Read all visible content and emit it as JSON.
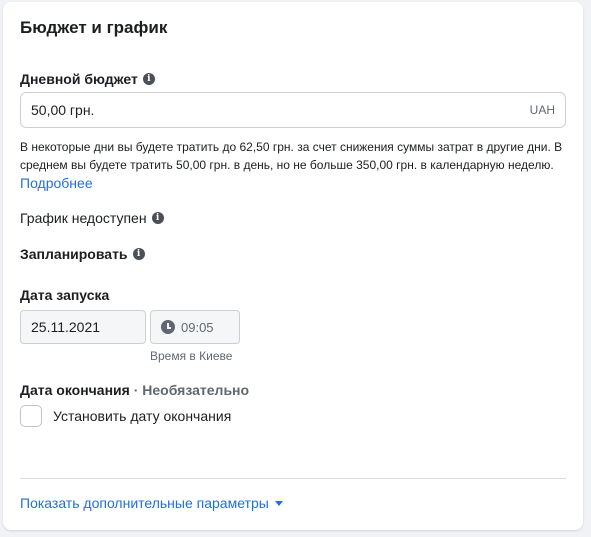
{
  "section": {
    "title": "Бюджет и график"
  },
  "budget": {
    "label": "Дневной бюджет",
    "value": "50,00 грн.",
    "currency": "UAH",
    "hint": "В некоторые дни вы будете тратить до 62,50 грн. за счет снижения суммы затрат в другие дни. В среднем вы будете тратить 50,00 грн. в день, но не больше 350,00 грн. в календарную неделю.",
    "learn_more": "Подробнее"
  },
  "schedule": {
    "unavailable_label": "График недоступен",
    "plan_label": "Запланировать"
  },
  "start": {
    "label": "Дата запуска",
    "date": "25.11.2021",
    "time": "09:05",
    "timezone": "Время в Киеве"
  },
  "end": {
    "label": "Дата окончания",
    "optional": " · Необязательно",
    "checkbox_label": "Установить дату окончания",
    "checked": false
  },
  "footer": {
    "more_options": "Показать дополнительные параметры"
  },
  "colors": {
    "link": "#216fdb",
    "text": "#1c1e21",
    "muted": "#606770",
    "border": "#ccd0d5"
  }
}
